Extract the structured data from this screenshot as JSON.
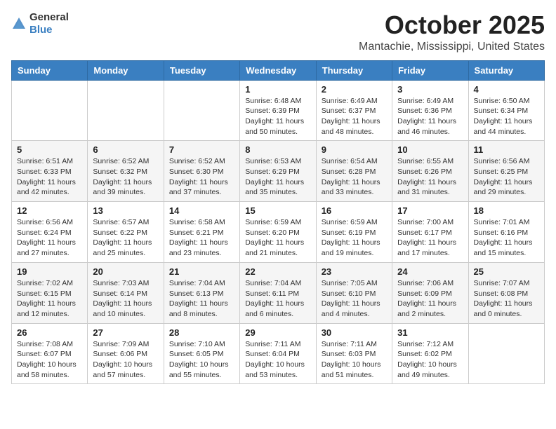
{
  "logo": {
    "general": "General",
    "blue": "Blue"
  },
  "header": {
    "month": "October 2025",
    "location": "Mantachie, Mississippi, United States"
  },
  "weekdays": [
    "Sunday",
    "Monday",
    "Tuesday",
    "Wednesday",
    "Thursday",
    "Friday",
    "Saturday"
  ],
  "weeks": [
    [
      {
        "day": "",
        "sunrise": "",
        "sunset": "",
        "daylight": ""
      },
      {
        "day": "",
        "sunrise": "",
        "sunset": "",
        "daylight": ""
      },
      {
        "day": "",
        "sunrise": "",
        "sunset": "",
        "daylight": ""
      },
      {
        "day": "1",
        "sunrise": "Sunrise: 6:48 AM",
        "sunset": "Sunset: 6:39 PM",
        "daylight": "Daylight: 11 hours and 50 minutes."
      },
      {
        "day": "2",
        "sunrise": "Sunrise: 6:49 AM",
        "sunset": "Sunset: 6:37 PM",
        "daylight": "Daylight: 11 hours and 48 minutes."
      },
      {
        "day": "3",
        "sunrise": "Sunrise: 6:49 AM",
        "sunset": "Sunset: 6:36 PM",
        "daylight": "Daylight: 11 hours and 46 minutes."
      },
      {
        "day": "4",
        "sunrise": "Sunrise: 6:50 AM",
        "sunset": "Sunset: 6:34 PM",
        "daylight": "Daylight: 11 hours and 44 minutes."
      }
    ],
    [
      {
        "day": "5",
        "sunrise": "Sunrise: 6:51 AM",
        "sunset": "Sunset: 6:33 PM",
        "daylight": "Daylight: 11 hours and 42 minutes."
      },
      {
        "day": "6",
        "sunrise": "Sunrise: 6:52 AM",
        "sunset": "Sunset: 6:32 PM",
        "daylight": "Daylight: 11 hours and 39 minutes."
      },
      {
        "day": "7",
        "sunrise": "Sunrise: 6:52 AM",
        "sunset": "Sunset: 6:30 PM",
        "daylight": "Daylight: 11 hours and 37 minutes."
      },
      {
        "day": "8",
        "sunrise": "Sunrise: 6:53 AM",
        "sunset": "Sunset: 6:29 PM",
        "daylight": "Daylight: 11 hours and 35 minutes."
      },
      {
        "day": "9",
        "sunrise": "Sunrise: 6:54 AM",
        "sunset": "Sunset: 6:28 PM",
        "daylight": "Daylight: 11 hours and 33 minutes."
      },
      {
        "day": "10",
        "sunrise": "Sunrise: 6:55 AM",
        "sunset": "Sunset: 6:26 PM",
        "daylight": "Daylight: 11 hours and 31 minutes."
      },
      {
        "day": "11",
        "sunrise": "Sunrise: 6:56 AM",
        "sunset": "Sunset: 6:25 PM",
        "daylight": "Daylight: 11 hours and 29 minutes."
      }
    ],
    [
      {
        "day": "12",
        "sunrise": "Sunrise: 6:56 AM",
        "sunset": "Sunset: 6:24 PM",
        "daylight": "Daylight: 11 hours and 27 minutes."
      },
      {
        "day": "13",
        "sunrise": "Sunrise: 6:57 AM",
        "sunset": "Sunset: 6:22 PM",
        "daylight": "Daylight: 11 hours and 25 minutes."
      },
      {
        "day": "14",
        "sunrise": "Sunrise: 6:58 AM",
        "sunset": "Sunset: 6:21 PM",
        "daylight": "Daylight: 11 hours and 23 minutes."
      },
      {
        "day": "15",
        "sunrise": "Sunrise: 6:59 AM",
        "sunset": "Sunset: 6:20 PM",
        "daylight": "Daylight: 11 hours and 21 minutes."
      },
      {
        "day": "16",
        "sunrise": "Sunrise: 6:59 AM",
        "sunset": "Sunset: 6:19 PM",
        "daylight": "Daylight: 11 hours and 19 minutes."
      },
      {
        "day": "17",
        "sunrise": "Sunrise: 7:00 AM",
        "sunset": "Sunset: 6:17 PM",
        "daylight": "Daylight: 11 hours and 17 minutes."
      },
      {
        "day": "18",
        "sunrise": "Sunrise: 7:01 AM",
        "sunset": "Sunset: 6:16 PM",
        "daylight": "Daylight: 11 hours and 15 minutes."
      }
    ],
    [
      {
        "day": "19",
        "sunrise": "Sunrise: 7:02 AM",
        "sunset": "Sunset: 6:15 PM",
        "daylight": "Daylight: 11 hours and 12 minutes."
      },
      {
        "day": "20",
        "sunrise": "Sunrise: 7:03 AM",
        "sunset": "Sunset: 6:14 PM",
        "daylight": "Daylight: 11 hours and 10 minutes."
      },
      {
        "day": "21",
        "sunrise": "Sunrise: 7:04 AM",
        "sunset": "Sunset: 6:13 PM",
        "daylight": "Daylight: 11 hours and 8 minutes."
      },
      {
        "day": "22",
        "sunrise": "Sunrise: 7:04 AM",
        "sunset": "Sunset: 6:11 PM",
        "daylight": "Daylight: 11 hours and 6 minutes."
      },
      {
        "day": "23",
        "sunrise": "Sunrise: 7:05 AM",
        "sunset": "Sunset: 6:10 PM",
        "daylight": "Daylight: 11 hours and 4 minutes."
      },
      {
        "day": "24",
        "sunrise": "Sunrise: 7:06 AM",
        "sunset": "Sunset: 6:09 PM",
        "daylight": "Daylight: 11 hours and 2 minutes."
      },
      {
        "day": "25",
        "sunrise": "Sunrise: 7:07 AM",
        "sunset": "Sunset: 6:08 PM",
        "daylight": "Daylight: 11 hours and 0 minutes."
      }
    ],
    [
      {
        "day": "26",
        "sunrise": "Sunrise: 7:08 AM",
        "sunset": "Sunset: 6:07 PM",
        "daylight": "Daylight: 10 hours and 58 minutes."
      },
      {
        "day": "27",
        "sunrise": "Sunrise: 7:09 AM",
        "sunset": "Sunset: 6:06 PM",
        "daylight": "Daylight: 10 hours and 57 minutes."
      },
      {
        "day": "28",
        "sunrise": "Sunrise: 7:10 AM",
        "sunset": "Sunset: 6:05 PM",
        "daylight": "Daylight: 10 hours and 55 minutes."
      },
      {
        "day": "29",
        "sunrise": "Sunrise: 7:11 AM",
        "sunset": "Sunset: 6:04 PM",
        "daylight": "Daylight: 10 hours and 53 minutes."
      },
      {
        "day": "30",
        "sunrise": "Sunrise: 7:11 AM",
        "sunset": "Sunset: 6:03 PM",
        "daylight": "Daylight: 10 hours and 51 minutes."
      },
      {
        "day": "31",
        "sunrise": "Sunrise: 7:12 AM",
        "sunset": "Sunset: 6:02 PM",
        "daylight": "Daylight: 10 hours and 49 minutes."
      },
      {
        "day": "",
        "sunrise": "",
        "sunset": "",
        "daylight": ""
      }
    ]
  ]
}
